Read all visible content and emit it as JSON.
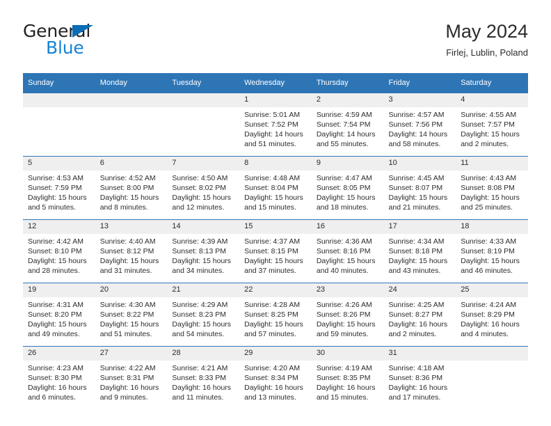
{
  "brand": {
    "word1": "General",
    "word2": "Blue",
    "triangle_color": "#0d6cb6",
    "blue_color": "#1683d4"
  },
  "header": {
    "title": "May 2024",
    "location": "Firlej, Lublin, Poland"
  },
  "theme": {
    "header_bg": "#2e75b6",
    "daynum_bg": "#efefef",
    "text": "#2b2b2b"
  },
  "calendar": {
    "weekday_headers": [
      "Sunday",
      "Monday",
      "Tuesday",
      "Wednesday",
      "Thursday",
      "Friday",
      "Saturday"
    ],
    "weeks": [
      [
        {
          "day": "",
          "lines": []
        },
        {
          "day": "",
          "lines": []
        },
        {
          "day": "",
          "lines": []
        },
        {
          "day": "1",
          "lines": [
            "Sunrise: 5:01 AM",
            "Sunset: 7:52 PM",
            "Daylight: 14 hours",
            "and 51 minutes."
          ]
        },
        {
          "day": "2",
          "lines": [
            "Sunrise: 4:59 AM",
            "Sunset: 7:54 PM",
            "Daylight: 14 hours",
            "and 55 minutes."
          ]
        },
        {
          "day": "3",
          "lines": [
            "Sunrise: 4:57 AM",
            "Sunset: 7:56 PM",
            "Daylight: 14 hours",
            "and 58 minutes."
          ]
        },
        {
          "day": "4",
          "lines": [
            "Sunrise: 4:55 AM",
            "Sunset: 7:57 PM",
            "Daylight: 15 hours",
            "and 2 minutes."
          ]
        }
      ],
      [
        {
          "day": "5",
          "lines": [
            "Sunrise: 4:53 AM",
            "Sunset: 7:59 PM",
            "Daylight: 15 hours",
            "and 5 minutes."
          ]
        },
        {
          "day": "6",
          "lines": [
            "Sunrise: 4:52 AM",
            "Sunset: 8:00 PM",
            "Daylight: 15 hours",
            "and 8 minutes."
          ]
        },
        {
          "day": "7",
          "lines": [
            "Sunrise: 4:50 AM",
            "Sunset: 8:02 PM",
            "Daylight: 15 hours",
            "and 12 minutes."
          ]
        },
        {
          "day": "8",
          "lines": [
            "Sunrise: 4:48 AM",
            "Sunset: 8:04 PM",
            "Daylight: 15 hours",
            "and 15 minutes."
          ]
        },
        {
          "day": "9",
          "lines": [
            "Sunrise: 4:47 AM",
            "Sunset: 8:05 PM",
            "Daylight: 15 hours",
            "and 18 minutes."
          ]
        },
        {
          "day": "10",
          "lines": [
            "Sunrise: 4:45 AM",
            "Sunset: 8:07 PM",
            "Daylight: 15 hours",
            "and 21 minutes."
          ]
        },
        {
          "day": "11",
          "lines": [
            "Sunrise: 4:43 AM",
            "Sunset: 8:08 PM",
            "Daylight: 15 hours",
            "and 25 minutes."
          ]
        }
      ],
      [
        {
          "day": "12",
          "lines": [
            "Sunrise: 4:42 AM",
            "Sunset: 8:10 PM",
            "Daylight: 15 hours",
            "and 28 minutes."
          ]
        },
        {
          "day": "13",
          "lines": [
            "Sunrise: 4:40 AM",
            "Sunset: 8:12 PM",
            "Daylight: 15 hours",
            "and 31 minutes."
          ]
        },
        {
          "day": "14",
          "lines": [
            "Sunrise: 4:39 AM",
            "Sunset: 8:13 PM",
            "Daylight: 15 hours",
            "and 34 minutes."
          ]
        },
        {
          "day": "15",
          "lines": [
            "Sunrise: 4:37 AM",
            "Sunset: 8:15 PM",
            "Daylight: 15 hours",
            "and 37 minutes."
          ]
        },
        {
          "day": "16",
          "lines": [
            "Sunrise: 4:36 AM",
            "Sunset: 8:16 PM",
            "Daylight: 15 hours",
            "and 40 minutes."
          ]
        },
        {
          "day": "17",
          "lines": [
            "Sunrise: 4:34 AM",
            "Sunset: 8:18 PM",
            "Daylight: 15 hours",
            "and 43 minutes."
          ]
        },
        {
          "day": "18",
          "lines": [
            "Sunrise: 4:33 AM",
            "Sunset: 8:19 PM",
            "Daylight: 15 hours",
            "and 46 minutes."
          ]
        }
      ],
      [
        {
          "day": "19",
          "lines": [
            "Sunrise: 4:31 AM",
            "Sunset: 8:20 PM",
            "Daylight: 15 hours",
            "and 49 minutes."
          ]
        },
        {
          "day": "20",
          "lines": [
            "Sunrise: 4:30 AM",
            "Sunset: 8:22 PM",
            "Daylight: 15 hours",
            "and 51 minutes."
          ]
        },
        {
          "day": "21",
          "lines": [
            "Sunrise: 4:29 AM",
            "Sunset: 8:23 PM",
            "Daylight: 15 hours",
            "and 54 minutes."
          ]
        },
        {
          "day": "22",
          "lines": [
            "Sunrise: 4:28 AM",
            "Sunset: 8:25 PM",
            "Daylight: 15 hours",
            "and 57 minutes."
          ]
        },
        {
          "day": "23",
          "lines": [
            "Sunrise: 4:26 AM",
            "Sunset: 8:26 PM",
            "Daylight: 15 hours",
            "and 59 minutes."
          ]
        },
        {
          "day": "24",
          "lines": [
            "Sunrise: 4:25 AM",
            "Sunset: 8:27 PM",
            "Daylight: 16 hours",
            "and 2 minutes."
          ]
        },
        {
          "day": "25",
          "lines": [
            "Sunrise: 4:24 AM",
            "Sunset: 8:29 PM",
            "Daylight: 16 hours",
            "and 4 minutes."
          ]
        }
      ],
      [
        {
          "day": "26",
          "lines": [
            "Sunrise: 4:23 AM",
            "Sunset: 8:30 PM",
            "Daylight: 16 hours",
            "and 6 minutes."
          ]
        },
        {
          "day": "27",
          "lines": [
            "Sunrise: 4:22 AM",
            "Sunset: 8:31 PM",
            "Daylight: 16 hours",
            "and 9 minutes."
          ]
        },
        {
          "day": "28",
          "lines": [
            "Sunrise: 4:21 AM",
            "Sunset: 8:33 PM",
            "Daylight: 16 hours",
            "and 11 minutes."
          ]
        },
        {
          "day": "29",
          "lines": [
            "Sunrise: 4:20 AM",
            "Sunset: 8:34 PM",
            "Daylight: 16 hours",
            "and 13 minutes."
          ]
        },
        {
          "day": "30",
          "lines": [
            "Sunrise: 4:19 AM",
            "Sunset: 8:35 PM",
            "Daylight: 16 hours",
            "and 15 minutes."
          ]
        },
        {
          "day": "31",
          "lines": [
            "Sunrise: 4:18 AM",
            "Sunset: 8:36 PM",
            "Daylight: 16 hours",
            "and 17 minutes."
          ]
        },
        {
          "day": "",
          "lines": []
        }
      ]
    ]
  }
}
